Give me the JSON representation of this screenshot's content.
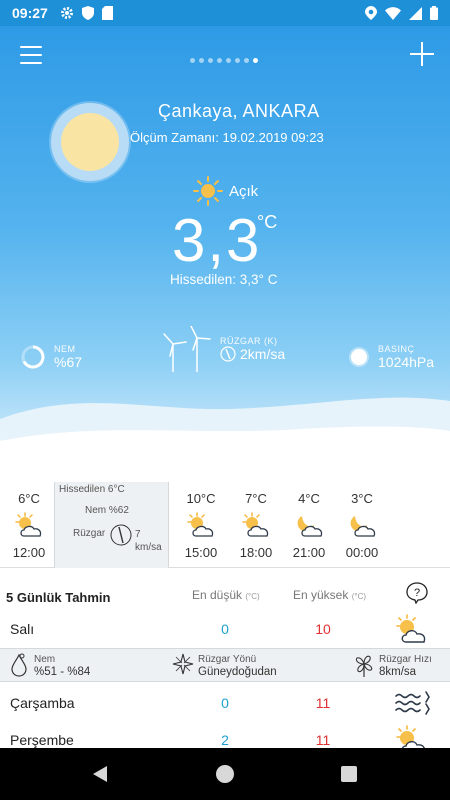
{
  "status_bar": {
    "time": "09:27",
    "battery_glyph": "▮"
  },
  "header": {
    "page_dots_total": 8,
    "page_dots_active_index": 7
  },
  "current": {
    "location": "Çankaya, ANKARA",
    "measure_time": "Ölçüm Zamanı: 19.02.2019 09:23",
    "condition": "Açık",
    "temperature": "3,3",
    "temperature_unit": "°C",
    "feels_like": "Hissedilen: 3,3° C"
  },
  "stats": {
    "humidity": {
      "label": "NEM",
      "value": "%67"
    },
    "wind": {
      "label": "RÜZGAR (K)",
      "value": "2km/sa"
    },
    "pressure": {
      "label": "BASINÇ",
      "value": "1024hPa"
    }
  },
  "hourly": [
    {
      "temp": "6°C",
      "hour": "12:00",
      "icon": "sun-cloud-icon"
    },
    {
      "temp": "10°C",
      "hour": "15:00",
      "icon": "sun-cloud-icon"
    },
    {
      "temp": "7°C",
      "hour": "18:00",
      "icon": "sun-cloud-icon"
    },
    {
      "temp": "4°C",
      "hour": "21:00",
      "icon": "moon-cloud-icon"
    },
    {
      "temp": "3°C",
      "hour": "00:00",
      "icon": "moon-cloud-icon"
    }
  ],
  "hourly_detail": {
    "feels": "Hissedilen 6°C",
    "humidity": "Nem %62",
    "wind_label": "Rüzgar",
    "wind_value_line1": "7",
    "wind_value_line2": "km/sa"
  },
  "forecast": {
    "title": "5 Günlük Tahmin",
    "low_header": "En düşük",
    "high_header": "En yüksek",
    "unit": "(°C)",
    "rows": [
      {
        "day": "Salı",
        "low": "0",
        "high": "10",
        "icon": "sun-cloud-icon"
      },
      {
        "day": "Çarşamba",
        "low": "0",
        "high": "11",
        "icon": "wind-waves-icon"
      },
      {
        "day": "Perşembe",
        "low": "2",
        "high": "11",
        "icon": "sun-cloud-icon"
      }
    ],
    "detail": {
      "humidity_label": "Nem",
      "humidity_value": "%51 - %84",
      "wind_dir_label": "Rüzgar Yönü",
      "wind_dir_value": "Güneydoğudan",
      "wind_speed_label": "Rüzgar Hızı",
      "wind_speed_value": "8km/sa"
    }
  }
}
